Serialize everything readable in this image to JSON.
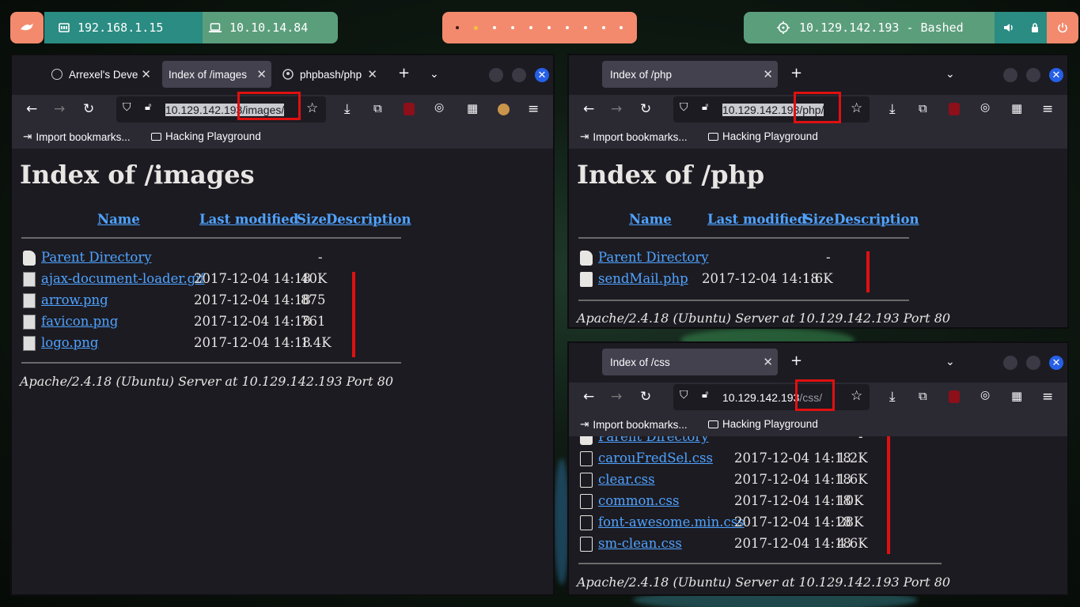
{
  "topbar": {
    "ip_local": "192.168.1.15",
    "ip_vpn": "10.10.14.84",
    "target": "10.129.142.193 - Bashed",
    "workspaces": [
      "",
      "",
      "",
      "",
      "",
      "",
      "",
      "",
      "",
      ""
    ]
  },
  "win1": {
    "tabs": [
      "Arrexel's Deve",
      "Index of /images",
      "phpbash/php"
    ],
    "url": {
      "host": "10.129.142.193",
      "path": "/images/"
    },
    "bookmarks": {
      "import": "Import bookmarks...",
      "folder": "Hacking Playground"
    },
    "heading": "Index of /images",
    "cols": {
      "name": "Name",
      "modified": "Last modified",
      "size": "Size",
      "desc": "Description"
    },
    "parent": {
      "name": "Parent Directory",
      "size": "-"
    },
    "rows": [
      {
        "name": "ajax-document-loader.gif",
        "modified": "2017-12-04 14:18",
        "size": "40K"
      },
      {
        "name": "arrow.png",
        "modified": "2017-12-04 14:18",
        "size": "875"
      },
      {
        "name": "favicon.png",
        "modified": "2017-12-04 14:18",
        "size": "761"
      },
      {
        "name": "logo.png",
        "modified": "2017-12-04 14:18",
        "size": "1.4K"
      }
    ],
    "footer": "Apache/2.4.18 (Ubuntu) Server at 10.129.142.193 Port 80"
  },
  "win2": {
    "tab": "Index of /php",
    "url": {
      "host": "10.129.142.193",
      "path": "/php/"
    },
    "bookmarks": {
      "import": "Import bookmarks...",
      "folder": "Hacking Playground"
    },
    "heading": "Index of /php",
    "cols": {
      "name": "Name",
      "modified": "Last modified",
      "size": "Size",
      "desc": "Description"
    },
    "parent": {
      "name": "Parent Directory",
      "size": "-"
    },
    "rows": [
      {
        "name": "sendMail.php",
        "modified": "2017-12-04 14:18",
        "size": "1.6K"
      }
    ],
    "footer": "Apache/2.4.18 (Ubuntu) Server at 10.129.142.193 Port 80"
  },
  "win3": {
    "tab": "Index of /css",
    "url": {
      "host": "10.129.142.193",
      "path": "/css/"
    },
    "bookmarks": {
      "import": "Import bookmarks...",
      "folder": "Hacking Playground"
    },
    "parent": {
      "name": "Parent Directory",
      "size": "-"
    },
    "rows": [
      {
        "name": "carouFredSel.css",
        "modified": "2017-12-04 14:18",
        "size": "1.2K"
      },
      {
        "name": "clear.css",
        "modified": "2017-12-04 14:18",
        "size": "1.6K"
      },
      {
        "name": "common.css",
        "modified": "2017-12-04 14:18",
        "size": "10K"
      },
      {
        "name": "font-awesome.min.css",
        "modified": "2017-12-04 14:18",
        "size": "28K"
      },
      {
        "name": "sm-clean.css",
        "modified": "2017-12-04 14:18",
        "size": "4.6K"
      }
    ],
    "footer": "Apache/2.4.18 (Ubuntu) Server at 10.129.142.193 Port 80"
  },
  "colors": {
    "accent_green": "#5b9e7c",
    "teal": "#2a8c82",
    "salmon": "#f38a6d",
    "highlight_red": "#e01010",
    "link": "#4fa3ff"
  }
}
